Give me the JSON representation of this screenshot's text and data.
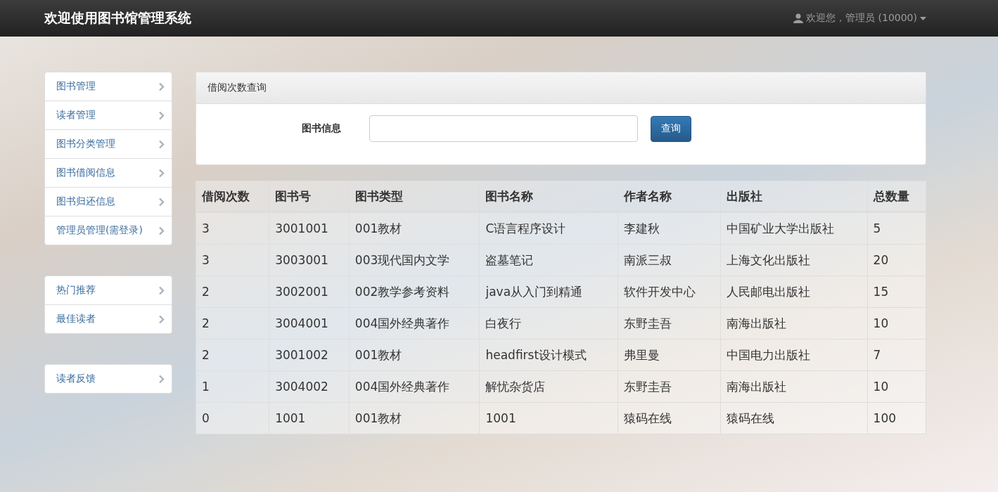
{
  "navbar": {
    "brand": "欢迎使用图书馆管理系统",
    "user_menu": "欢迎您，管理员 (10000)"
  },
  "sidebar": {
    "groups": [
      {
        "items": [
          {
            "label": "图书管理"
          },
          {
            "label": "读者管理"
          },
          {
            "label": "图书分类管理"
          },
          {
            "label": "图书借阅信息"
          },
          {
            "label": "图书归还信息"
          },
          {
            "label": "管理员管理(需登录)"
          }
        ]
      },
      {
        "items": [
          {
            "label": "热门推荐"
          },
          {
            "label": "最佳读者"
          }
        ]
      },
      {
        "items": [
          {
            "label": "读者反馈"
          }
        ]
      }
    ]
  },
  "search_panel": {
    "title": "借阅次数查询",
    "field_label": "图书信息",
    "button": "查询"
  },
  "table": {
    "columns": [
      "借阅次数",
      "图书号",
      "图书类型",
      "图书名称",
      "作者名称",
      "出版社",
      "总数量"
    ],
    "rows": [
      [
        "3",
        "3001001",
        "001教材",
        "C语言程序设计",
        "李建秋",
        "中国矿业大学出版社",
        "5"
      ],
      [
        "3",
        "3003001",
        "003现代国内文学",
        "盗墓笔记",
        "南派三叔",
        "上海文化出版社",
        "20"
      ],
      [
        "2",
        "3002001",
        "002教学参考资料",
        "java从入门到精通",
        "软件开发中心",
        "人民邮电出版社",
        "15"
      ],
      [
        "2",
        "3004001",
        "004国外经典著作",
        "白夜行",
        "东野圭吾",
        "南海出版社",
        "10"
      ],
      [
        "2",
        "3001002",
        "001教材",
        "headfirst设计模式",
        "弗里曼",
        "中国电力出版社",
        "7"
      ],
      [
        "1",
        "3004002",
        "004国外经典著作",
        "解忧杂货店",
        "东野圭吾",
        "南海出版社",
        "10"
      ],
      [
        "0",
        "1001",
        "001教材",
        "1001",
        "猿码在线",
        "猿码在线",
        "100"
      ]
    ]
  }
}
